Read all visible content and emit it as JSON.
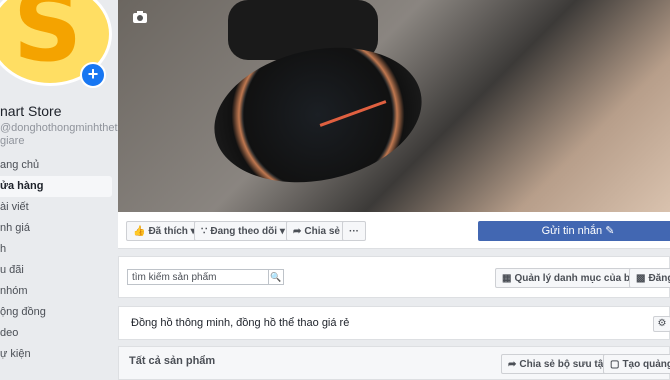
{
  "page": {
    "store_name": "nart Store",
    "store_handle": "@donghothongminhtheth giare",
    "avatar_letter": "S",
    "avatar_add": "+"
  },
  "nav": {
    "items": [
      {
        "label": "ang chủ"
      },
      {
        "label": "ửa hàng"
      },
      {
        "label": "ài viết"
      },
      {
        "label": "nh giá"
      },
      {
        "label": "h"
      },
      {
        "label": "u đãi"
      },
      {
        "label": "nhóm"
      },
      {
        "label": "ộng đồng"
      },
      {
        "label": "deo"
      },
      {
        "label": "ự kiện"
      }
    ],
    "active_index": 1
  },
  "actions": {
    "like": "Đã thích",
    "follow": "Đang theo dõi",
    "share": "Chia sẻ",
    "more": "···",
    "send_message": "Gửi tin nhắn"
  },
  "search": {
    "value": "tìm kiếm sản phẩm",
    "manage_label": "Quản lý danh mục của bạn",
    "register_label": "Đăng K"
  },
  "description": {
    "text": "Đồng hồ thông minh, đồng hồ thể thao giá rẻ"
  },
  "products": {
    "title": "Tất cả sản phẩm",
    "share_collection": "Chia sẻ bộ sưu tập",
    "create_ad": "Tạo quảng cá"
  },
  "colors": {
    "brand_blue": "#4267b2",
    "avatar_yellow": "#ffde63",
    "avatar_letter": "#f4a300",
    "background": "#e9ebee"
  },
  "icons": {
    "camera": "camera-icon",
    "search": "search-icon",
    "gear": "gear-icon",
    "pencil": "pencil-icon",
    "thumbs_up": "thumbs-up-icon",
    "rss": "rss-icon",
    "share": "share-icon",
    "grid": "grid-icon",
    "add_square": "add-square-icon"
  }
}
